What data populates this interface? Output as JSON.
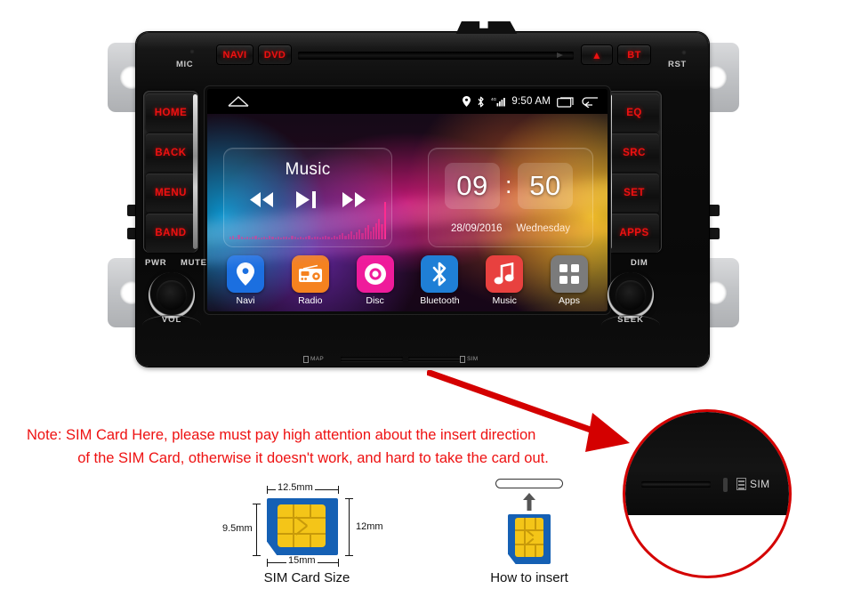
{
  "head_unit": {
    "top_strip": {
      "mic_label": "MIC",
      "rst_label": "RST",
      "buttons": [
        {
          "id": "navi",
          "label": "NAVI"
        },
        {
          "id": "dvd",
          "label": "DVD"
        },
        {
          "id": "eject",
          "label": "▲"
        },
        {
          "id": "bt",
          "label": "BT"
        }
      ]
    },
    "left_buttons": [
      {
        "id": "home",
        "label": "HOME"
      },
      {
        "id": "back",
        "label": "BACK"
      },
      {
        "id": "menu",
        "label": "MENU"
      },
      {
        "id": "band",
        "label": "BAND"
      }
    ],
    "right_buttons": [
      {
        "id": "eq",
        "label": "EQ"
      },
      {
        "id": "src",
        "label": "SRC"
      },
      {
        "id": "set",
        "label": "SET"
      },
      {
        "id": "apps",
        "label": "APPS"
      }
    ],
    "bottom": {
      "pwr_label": "PWR",
      "mute_label": "MUTE",
      "dim_label": "DIM",
      "vol_label": "VOL",
      "seek_label": "SEEK",
      "map_slot_label": "MAP",
      "sim_slot_label": "SIM"
    },
    "button_text_color": "#ee1111",
    "label_text_color": "#c9c9c9"
  },
  "screen": {
    "statusbar": {
      "home_icon": "home-icon",
      "icons": [
        "location-pin-icon",
        "bluetooth-icon",
        "signal-bars-icon"
      ],
      "time": "9:50 AM",
      "recents_icon": "recents-icon",
      "back_icon": "back-arrow-icon"
    },
    "music_widget": {
      "title": "Music",
      "prev_icon": "rewind-icon",
      "playpause_icon": "play-pause-icon",
      "next_icon": "fast-forward-icon",
      "equalizer_color": "#ff2b8f"
    },
    "clock_widget": {
      "hours": "09",
      "separator": ":",
      "minutes": "50",
      "date": "28/09/2016",
      "weekday": "Wednesday"
    },
    "dock": [
      {
        "id": "navi",
        "label": "Navi",
        "icon": "location-pin-icon",
        "color": "#1b6fe0"
      },
      {
        "id": "radio",
        "label": "Radio",
        "icon": "radio-icon",
        "color": "#f5821f"
      },
      {
        "id": "disc",
        "label": "Disc",
        "icon": "disc-icon",
        "color": "#ef1b9b"
      },
      {
        "id": "bluetooth",
        "label": "Bluetooth",
        "icon": "bluetooth-icon",
        "color": "#1f7fd6"
      },
      {
        "id": "music",
        "label": "Music",
        "icon": "music-note-icon",
        "color": "#e8413f"
      },
      {
        "id": "apps",
        "label": "Apps",
        "icon": "apps-grid-icon",
        "color": "#7b7b7b"
      }
    ]
  },
  "annotation": {
    "note_line1": "Note: SIM Card Here, please must pay high attention about the insert direction",
    "note_line2": "of the SIM Card, otherwise it doesn't work, and hard to take the card out.",
    "note_color": "#ee1111",
    "arrow_color": "#d40000",
    "magnifier": {
      "sim_label": "SIM"
    }
  },
  "sim_size_diagram": {
    "caption": "SIM Card Size",
    "width_top": "12.5mm",
    "width_bottom": "15mm",
    "height_left": "9.5mm",
    "height_right": "12mm",
    "card_color": "#1560b4",
    "chip_color": "#f4c518"
  },
  "insert_diagram": {
    "caption": "How to insert",
    "arrow_icon": "up-arrow-icon",
    "slot_icon": "card-slot-icon"
  }
}
